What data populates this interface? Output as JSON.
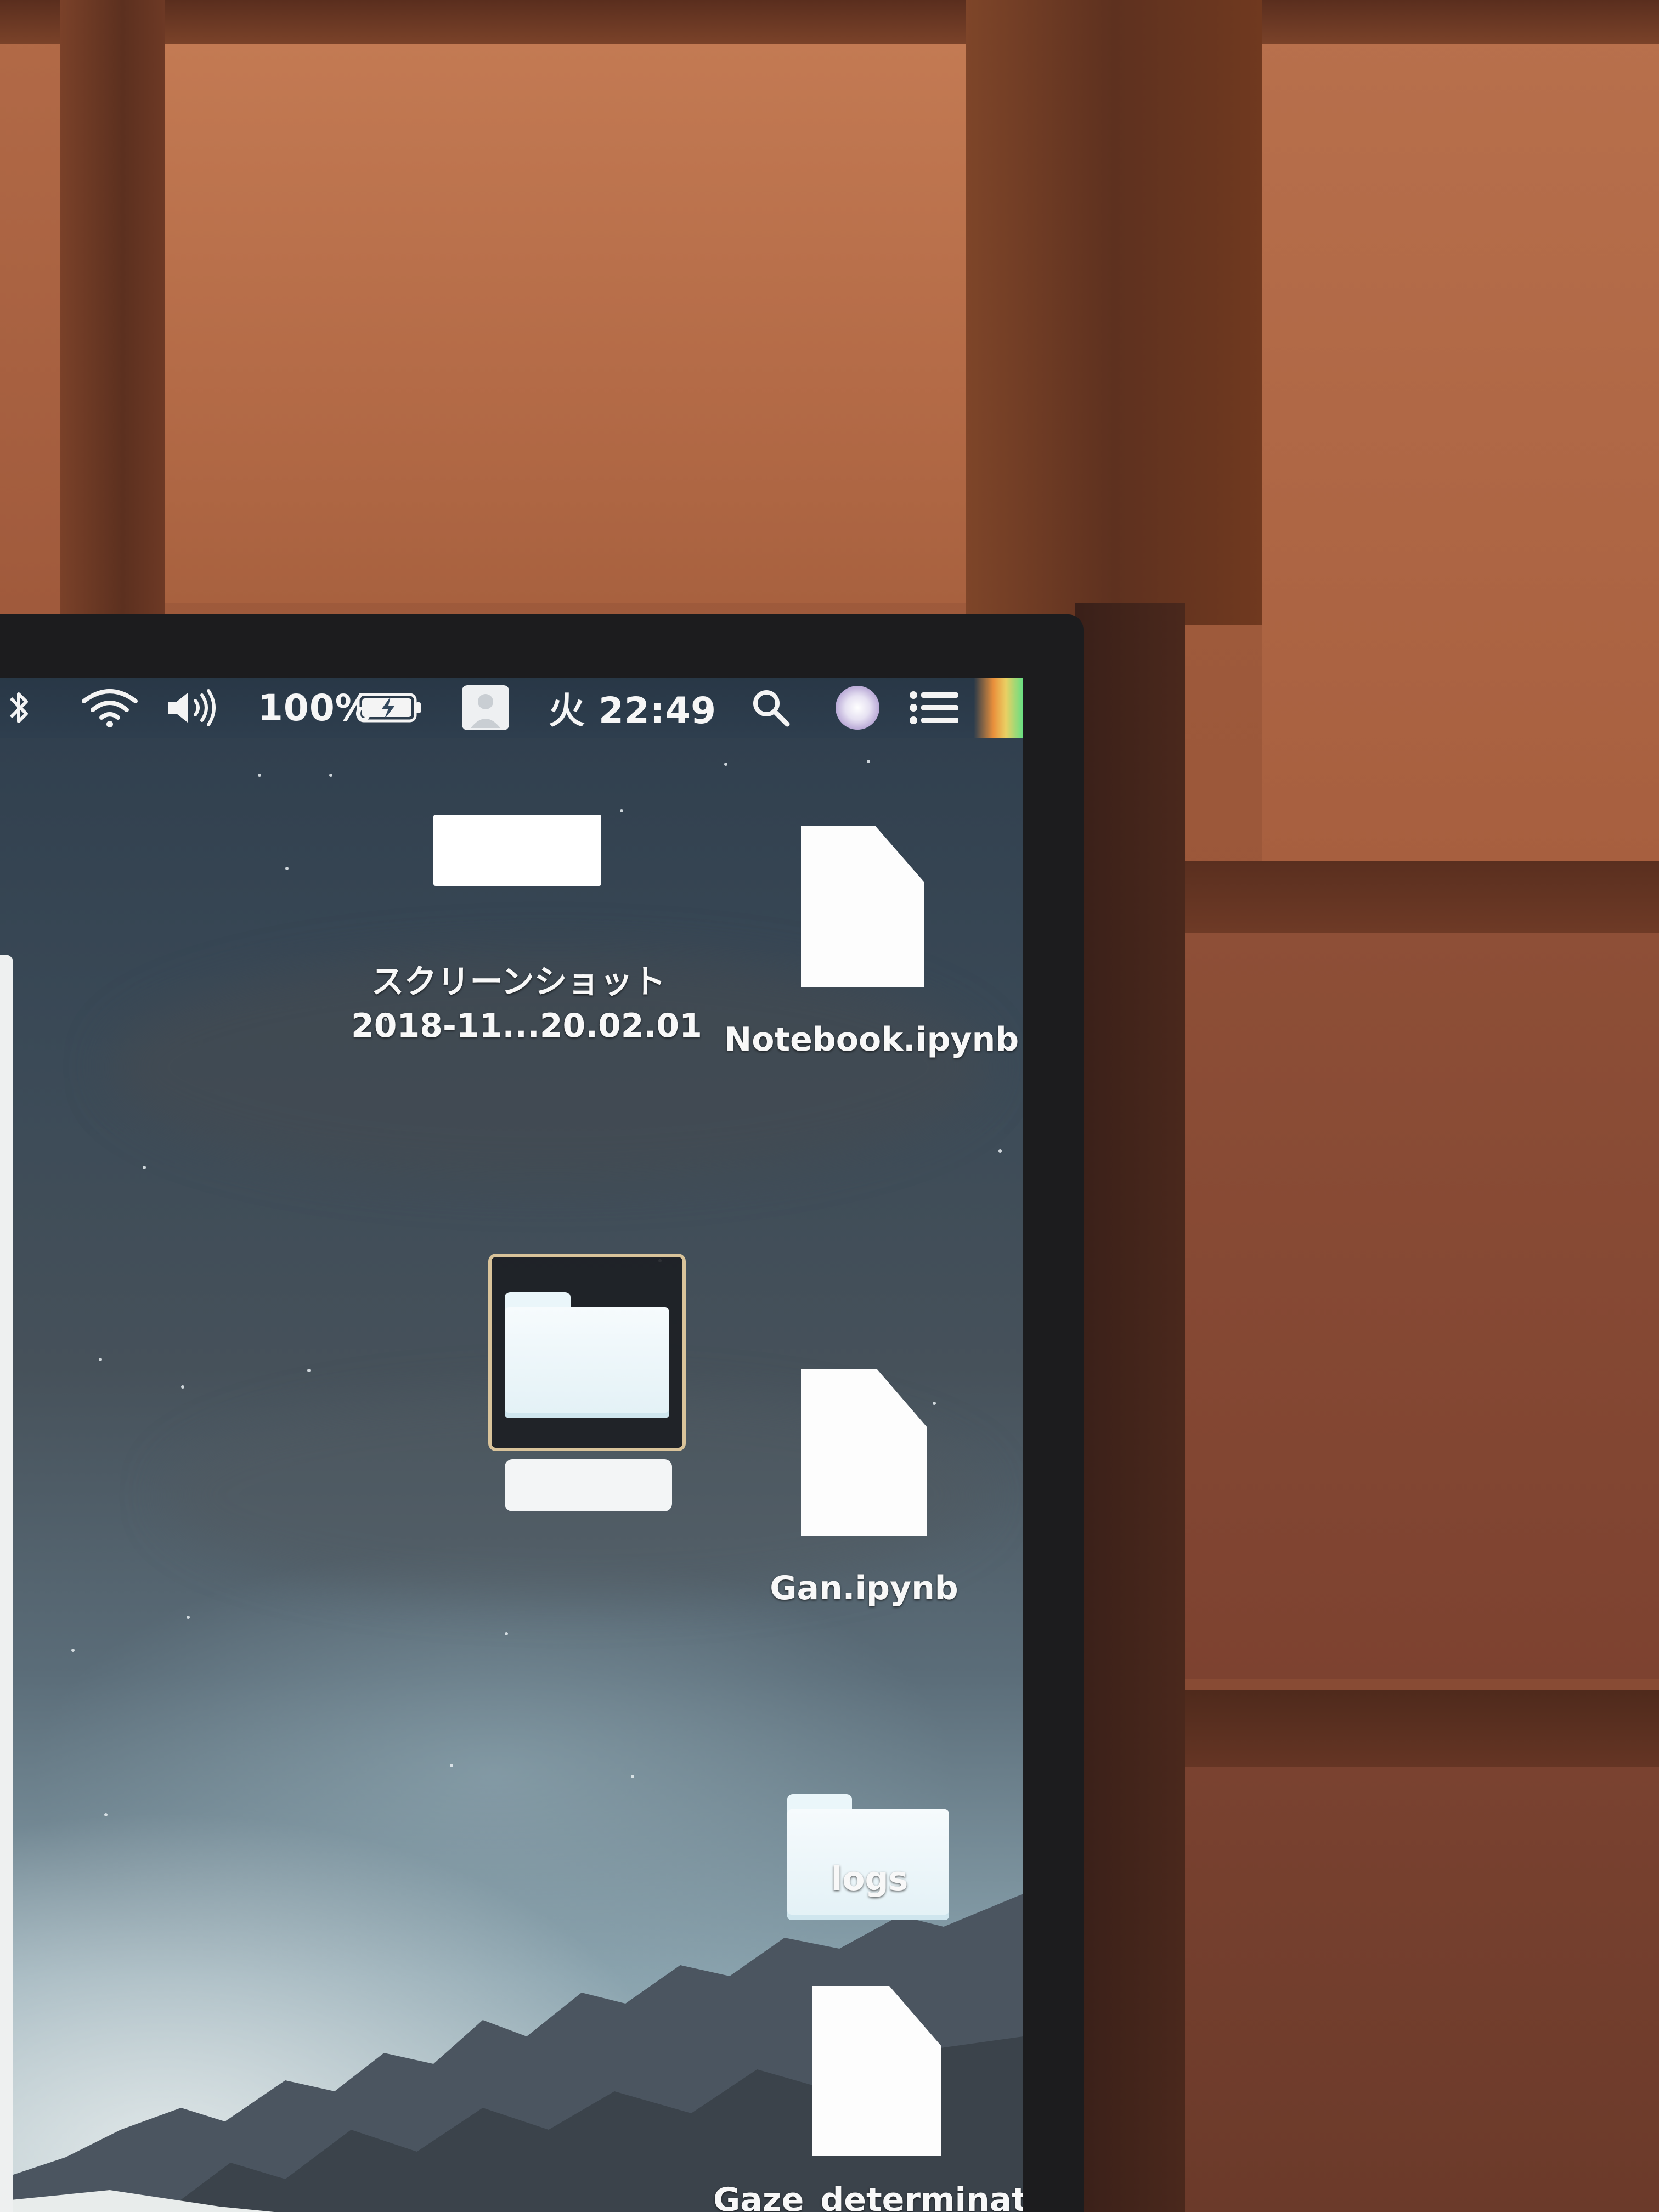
{
  "menubar": {
    "battery_percent": "100%",
    "clock": "火 22:49",
    "icons": [
      "bluetooth-icon",
      "wifi-icon",
      "volume-icon",
      "battery-icon",
      "user-icon",
      "search-icon",
      "siri-icon",
      "notification-center-icon"
    ]
  },
  "desktop": {
    "items": [
      {
        "kind": "screenshot",
        "label_line1": "スクリーンショット",
        "label_line2": "2018-11...20.02.01"
      },
      {
        "kind": "document",
        "label": "Notebook.ipynb"
      },
      {
        "kind": "folder",
        "label": "",
        "selected": true
      },
      {
        "kind": "document",
        "label": "Gan.ipynb"
      },
      {
        "kind": "folder",
        "label": "logs"
      },
      {
        "kind": "document",
        "label": "Gaze_determinator"
      }
    ]
  }
}
